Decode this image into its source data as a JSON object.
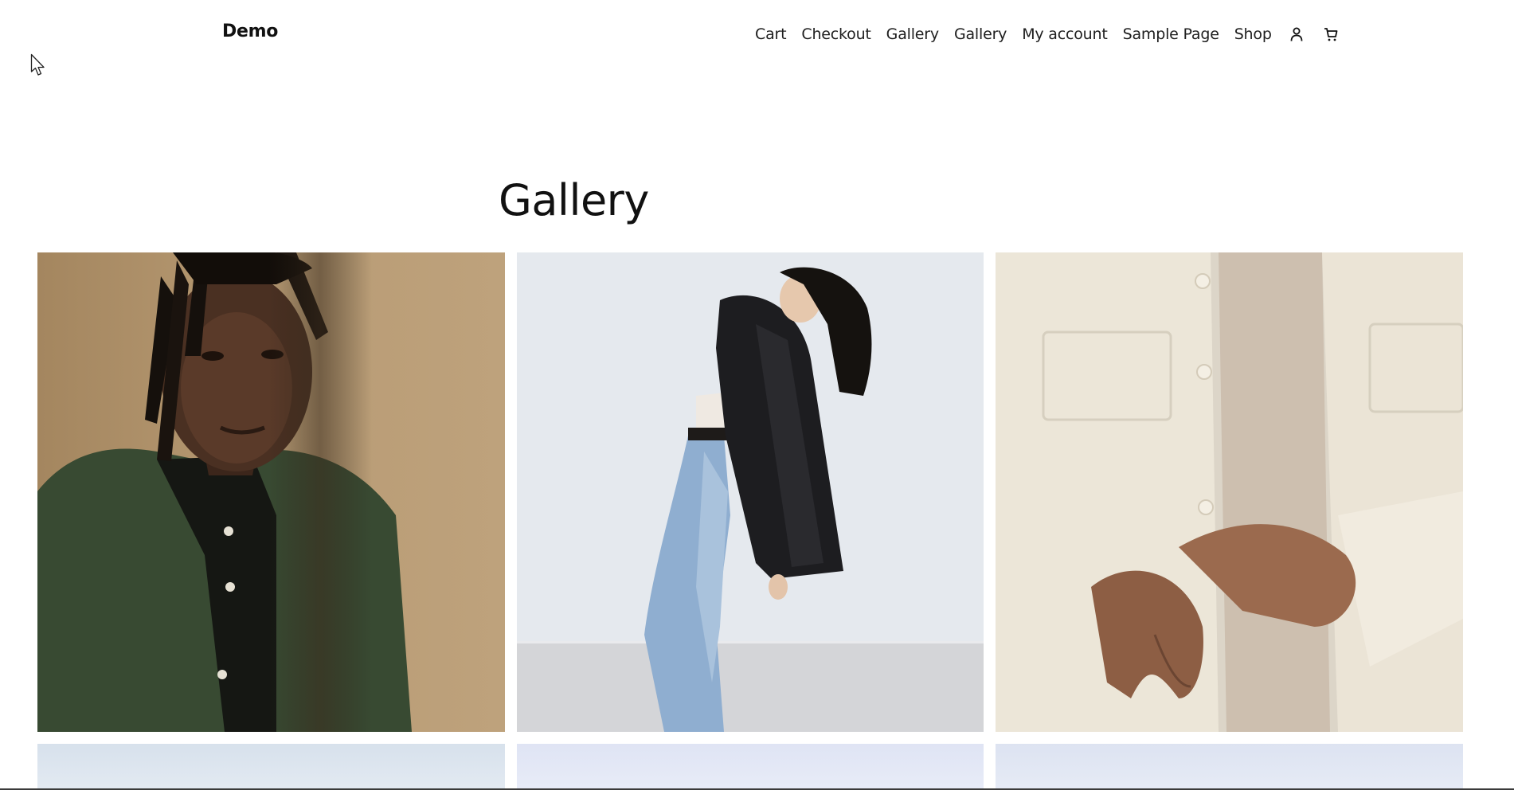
{
  "site": {
    "title": "Demo"
  },
  "nav": {
    "items": [
      "Cart",
      "Checkout",
      "Gallery",
      "Gallery",
      "My account",
      "Sample Page",
      "Shop"
    ],
    "icons": [
      "account-icon",
      "cart-icon"
    ]
  },
  "main": {
    "title": "Gallery"
  },
  "gallery": {
    "images": [
      {
        "alt": "portrait-man-dreadlocks-green-shirt"
      },
      {
        "alt": "woman-leaning-back-black-blazer-jeans"
      },
      {
        "alt": "hands-cream-corduroy-shirt"
      },
      {
        "alt": "gallery-image-4"
      },
      {
        "alt": "gallery-image-5"
      },
      {
        "alt": "gallery-image-6"
      }
    ]
  },
  "colors": {
    "text": "#111111",
    "background": "#ffffff"
  }
}
